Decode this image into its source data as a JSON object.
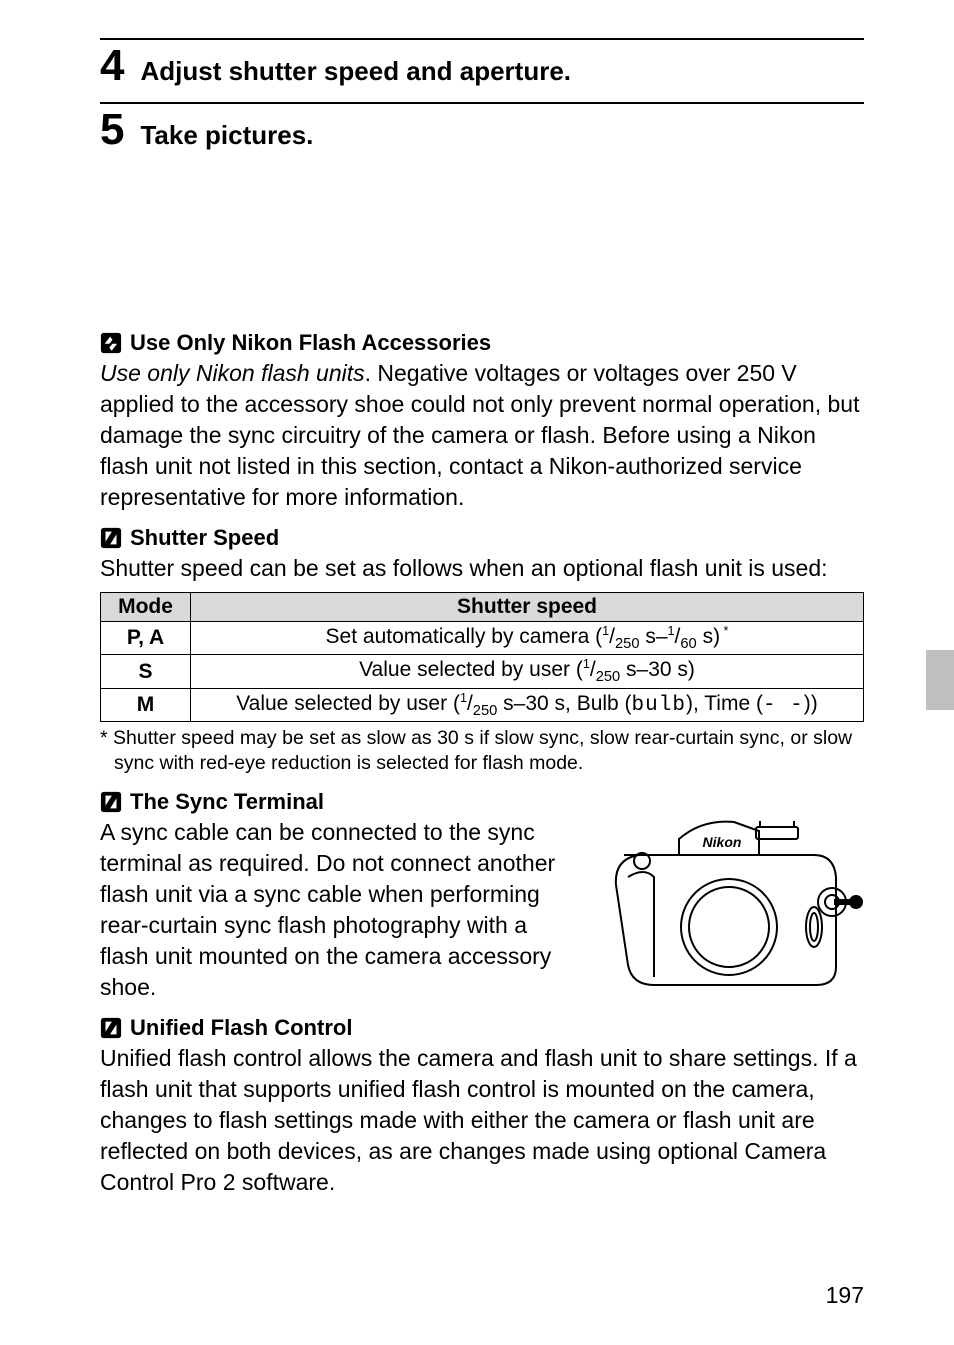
{
  "steps": [
    {
      "num": "4",
      "text": "Adjust shutter speed and aperture."
    },
    {
      "num": "5",
      "text": "Take pictures."
    }
  ],
  "warn_nikon": {
    "title": "Use Only Nikon Flash Accessories",
    "lead_italic": "Use only Nikon flash units",
    "body_rest": ".  Negative voltages or voltages over 250 V applied to the accessory shoe could not only prevent normal operation, but damage the sync circuitry of the camera or flash.  Before using a Nikon flash unit not listed in this section, contact a Nikon-authorized service representative for more information."
  },
  "shutter_speed": {
    "title": "Shutter Speed",
    "intro": "Shutter speed can be set as follows when an optional flash unit is used:",
    "table": {
      "head_mode": "Mode",
      "head_ss": "Shutter speed",
      "rows": [
        {
          "mode": "P, A",
          "pre": "Set automatically by camera (",
          "f1n": "1",
          "f1d": "250",
          "mid": " s–",
          "f2n": "1",
          "f2d": "60",
          "post": " s)",
          "star": " *"
        },
        {
          "mode": "S",
          "pre": "Value selected by user (",
          "f1n": "1",
          "f1d": "250",
          "post": " s–30 s)"
        },
        {
          "mode": "M",
          "pre": "Value selected by user (",
          "f1n": "1",
          "f1d": "250",
          "mid": " s–30 s, Bulb (",
          "lcd1": "bulb",
          "mid2": "), Time (",
          "lcd2": "- -",
          "post": "))"
        }
      ]
    },
    "footnote": "*  Shutter speed may be set as slow as 30 s if slow sync, slow rear-curtain sync, or slow sync with red-eye reduction is selected for flash mode."
  },
  "sync_terminal": {
    "title": "The Sync Terminal",
    "body": "A sync cable can be connected to the sync terminal as required.  Do not connect another flash unit via a sync cable when performing rear-curtain sync flash photography with a flash unit mounted on the camera accessory shoe."
  },
  "unified_flash": {
    "title": "Unified Flash Control",
    "body": "Unified flash control allows the camera and flash unit to share settings.  If a flash unit that supports unified flash control is mounted on the camera, changes to flash settings made with either the camera or flash unit are reflected on both devices, as are changes made using optional Camera Control Pro 2 software."
  },
  "page_number": "197",
  "brand_on_camera": "Nikon"
}
